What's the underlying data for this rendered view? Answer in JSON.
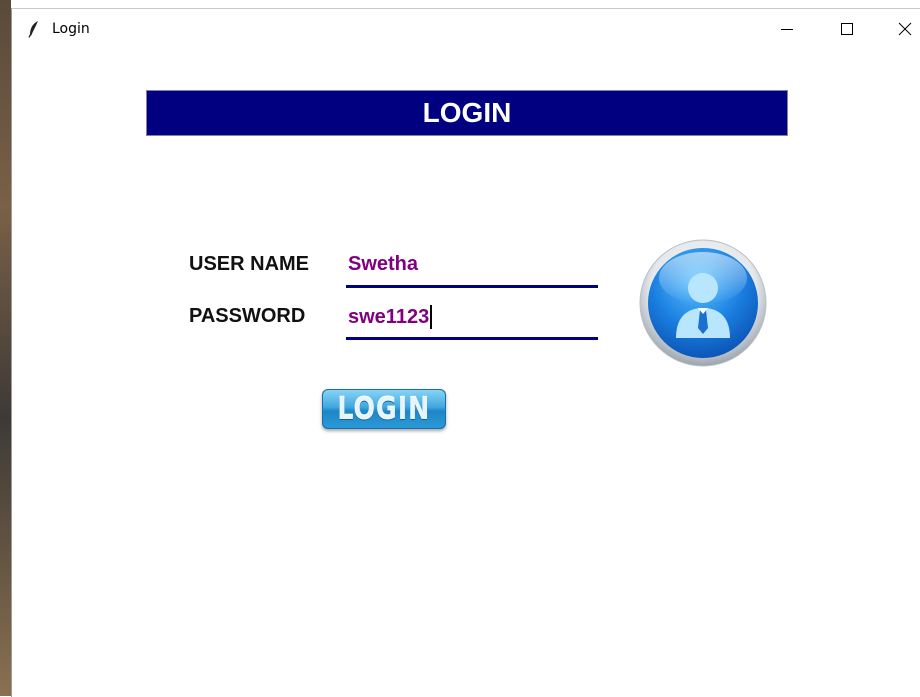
{
  "window": {
    "title": "Login",
    "controls": {
      "minimize_icon": "minimize-icon",
      "maximize_icon": "maximize-icon",
      "close_icon": "close-icon"
    },
    "app_icon": "feather-icon"
  },
  "header": {
    "title": "LOGIN",
    "background": "#000080"
  },
  "form": {
    "username_label": "USER NAME",
    "username_value": "Swetha",
    "password_label": "PASSWORD",
    "password_value": "swe1123",
    "value_color": "#800080",
    "underline_color": "#000080"
  },
  "avatar": {
    "icon": "user-avatar-icon"
  },
  "login_button": {
    "label": "LOGIN"
  }
}
